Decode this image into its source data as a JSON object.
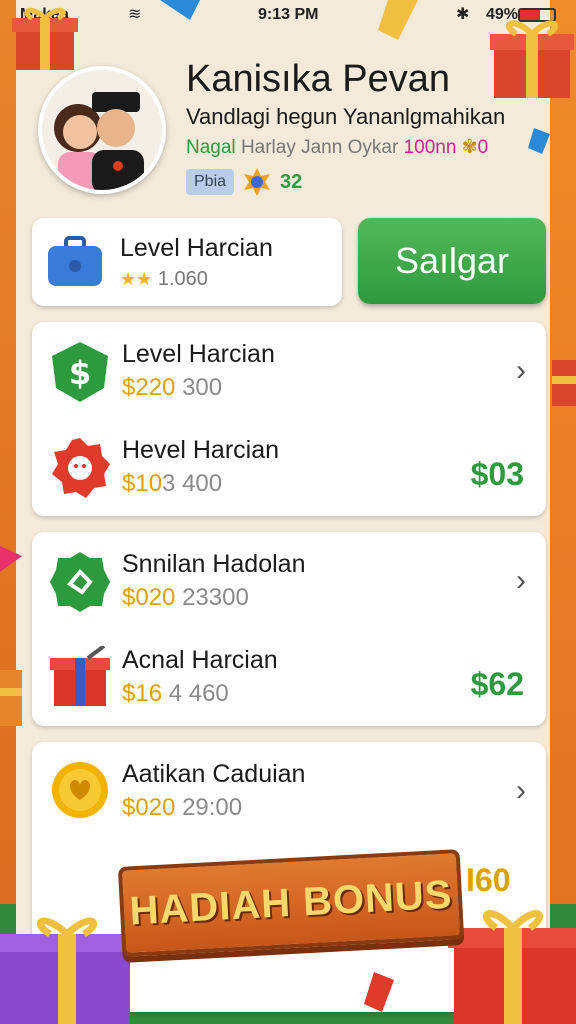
{
  "status": {
    "carrier": "Makaa",
    "time": "9:13 PM",
    "battery_pct": "49%"
  },
  "profile": {
    "name": "Kanisıka Pevan",
    "subtitle": "Vandlagi hegun Yananlgmahikan",
    "meta": {
      "part1": "Nagal",
      "part2": "Harlay Jann Oykar",
      "part3": "100nn",
      "part4": "0"
    },
    "tag": "Pbia",
    "tag_count": "32"
  },
  "top_card": {
    "title": "Level Harcian",
    "sub": "1.060"
  },
  "save_button": "Saılgar",
  "groups": [
    [
      {
        "title": "Level Harcian",
        "amount_main": "$220",
        "amount_alt": "300",
        "right": "chevron",
        "price": ""
      },
      {
        "title": "Hevel Harcian",
        "amount_main": "$10",
        "amount_alt": "3 400",
        "right": "price",
        "price": "$03"
      }
    ],
    [
      {
        "title": "Snnilan Hadolan",
        "amount_main": "$020",
        "amount_alt": "23300",
        "right": "chevron",
        "price": ""
      },
      {
        "title": "Acnal Harcian",
        "amount_main": "$16",
        "amount_alt": "4 460",
        "right": "price",
        "price": "$62"
      }
    ],
    [
      {
        "title": "Aatikan Caduian",
        "amount_main": "$020",
        "amount_alt": "29:00",
        "right": "chevron",
        "price": ""
      }
    ]
  ],
  "banner": {
    "label": "HADIAH BONUS",
    "side_price": "I60"
  },
  "icons": [
    "briefcase-icon",
    "star-icon",
    "dollar-shield-icon",
    "red-badge-icon",
    "green-badge-icon",
    "gift-box-icon",
    "gold-coin-icon",
    "chevron-right-icon"
  ],
  "colors": {
    "accent_green": "#2e9a3e",
    "accent_gold": "#e0a000",
    "orange_bg": "#e8842a",
    "panel": "#f3ead9"
  }
}
